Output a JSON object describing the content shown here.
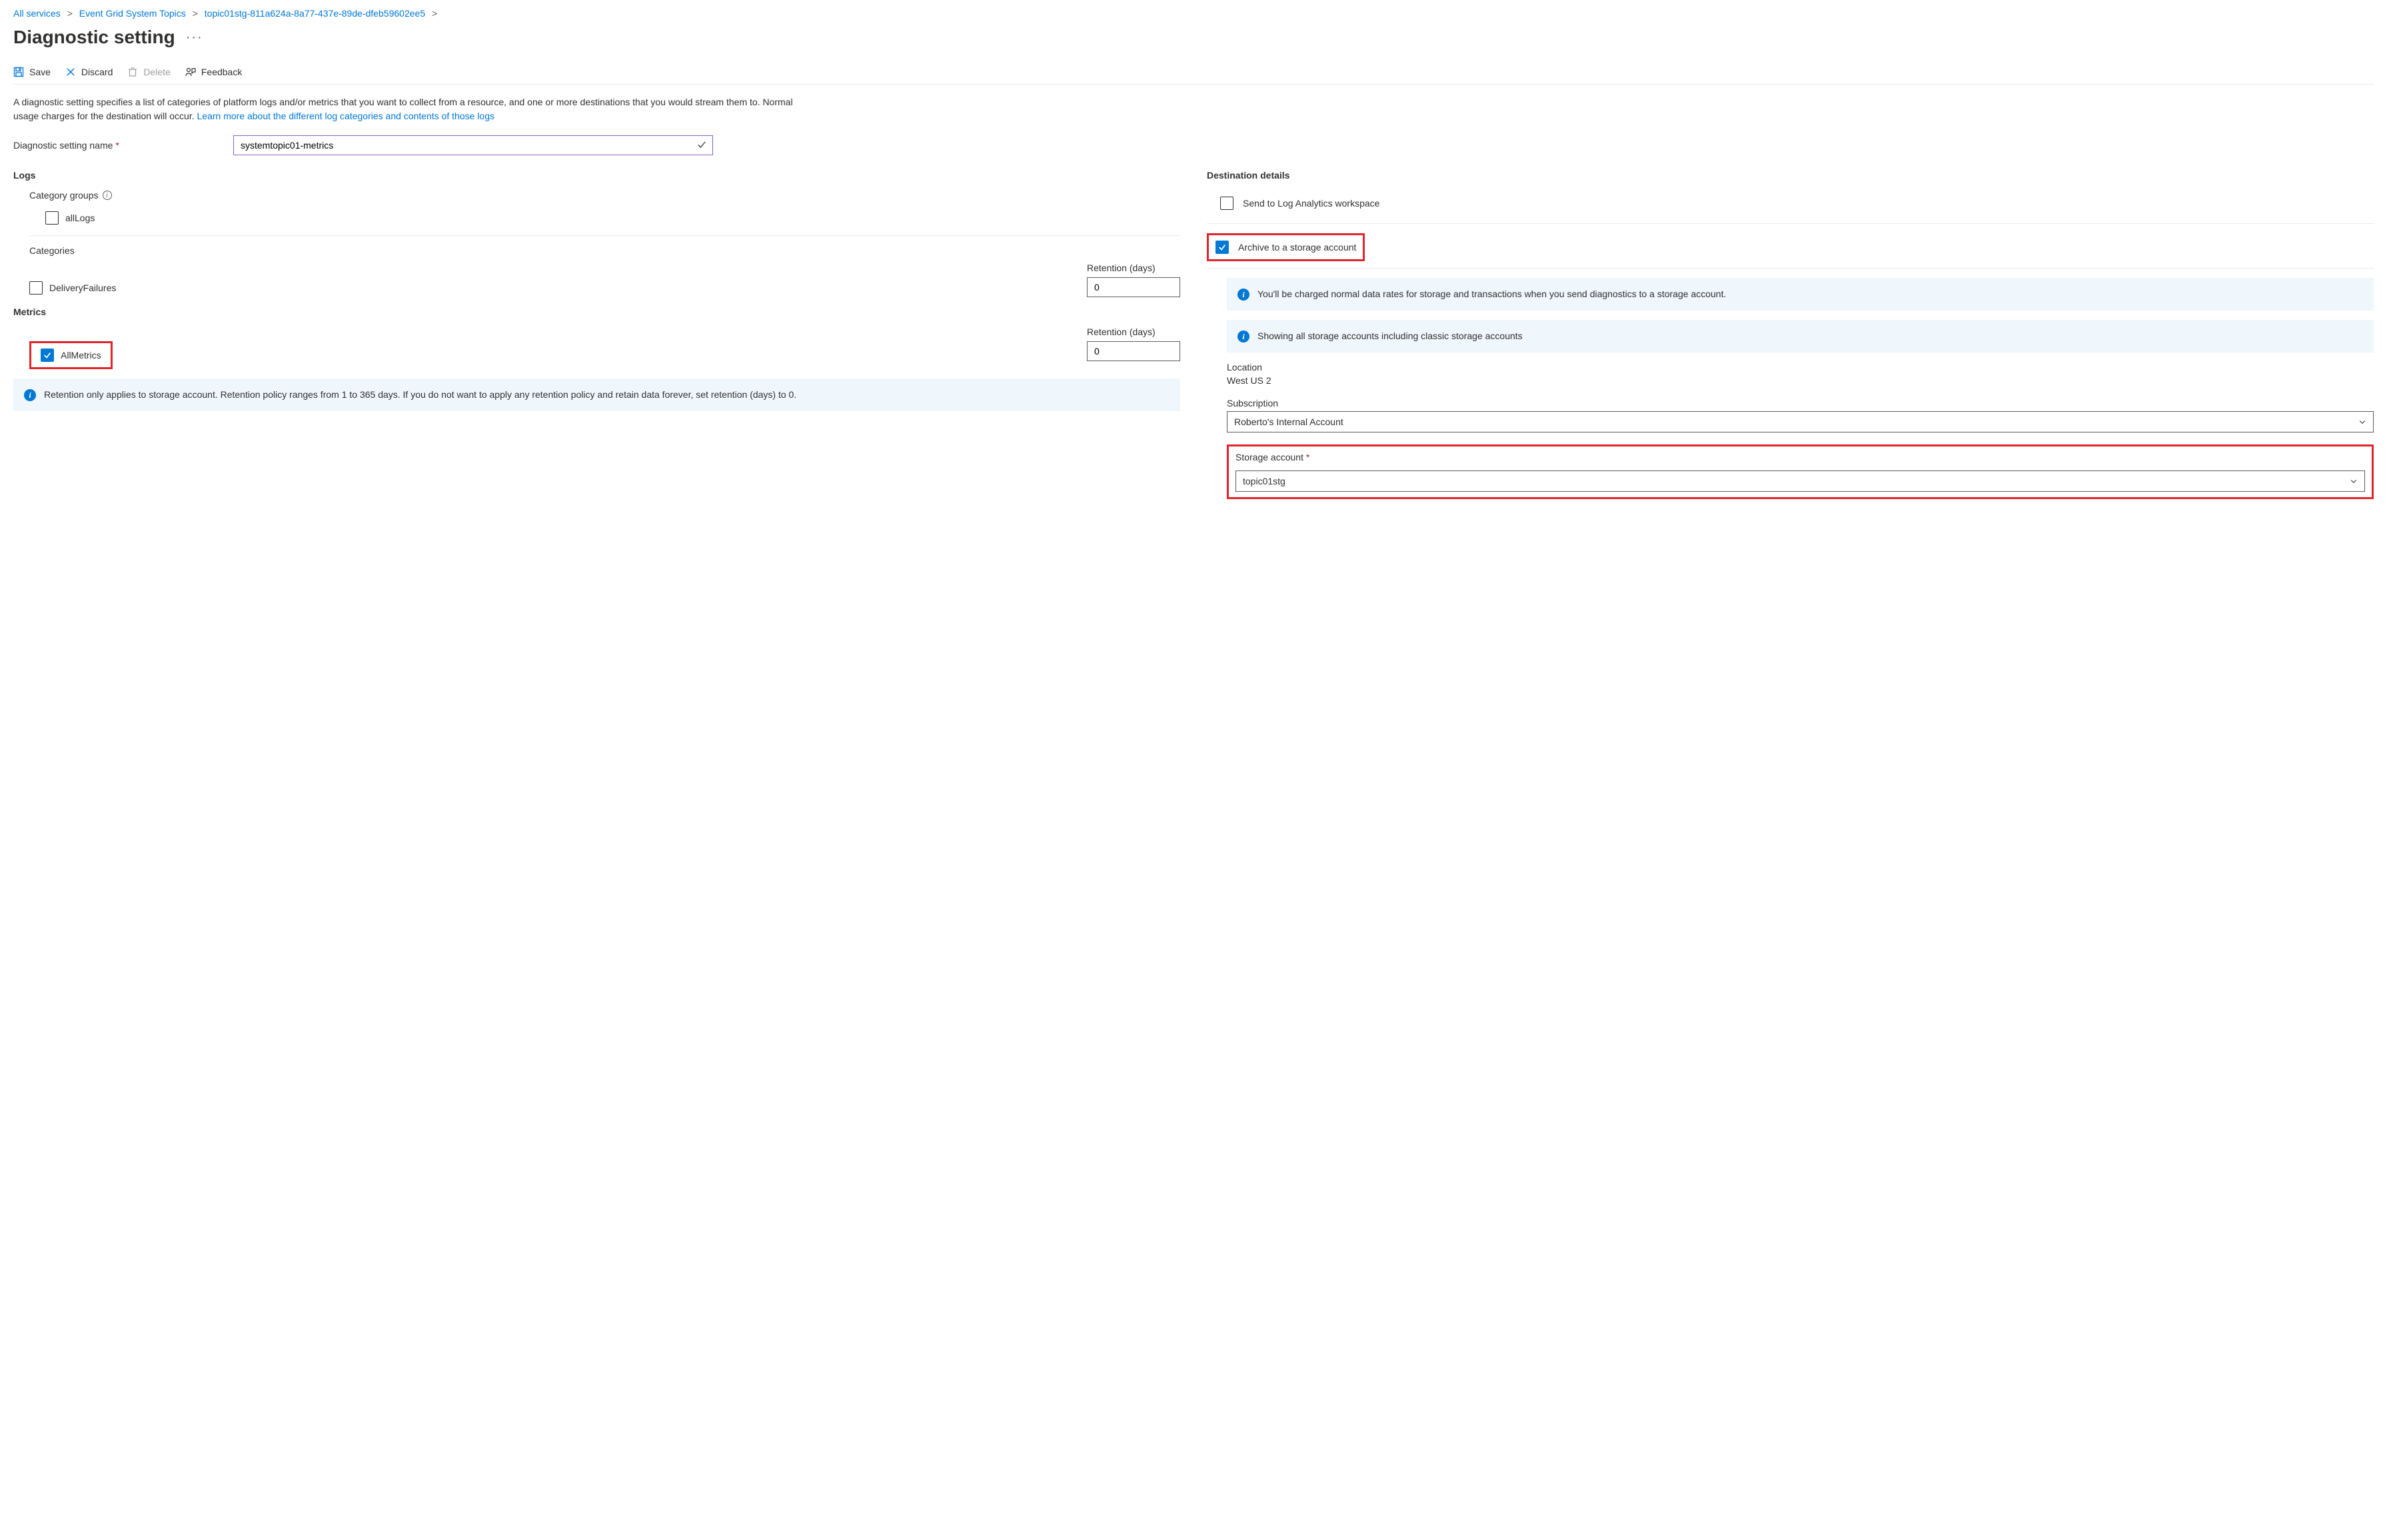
{
  "breadcrumb": {
    "items": [
      "All services",
      "Event Grid System Topics",
      "topic01stg-811a624a-8a77-437e-89de-dfeb59602ee5"
    ]
  },
  "title": "Diagnostic setting",
  "toolbar": {
    "save": "Save",
    "discard": "Discard",
    "delete": "Delete",
    "feedback": "Feedback"
  },
  "description": {
    "text": "A diagnostic setting specifies a list of categories of platform logs and/or metrics that you want to collect from a resource, and one or more destinations that you would stream them to. Normal usage charges for the destination will occur. ",
    "link": "Learn more about the different log categories and contents of those logs"
  },
  "name_field": {
    "label": "Diagnostic setting name",
    "value": "systemtopic01-metrics"
  },
  "logs": {
    "heading": "Logs",
    "category_groups_label": "Category groups",
    "all_logs": {
      "label": "allLogs",
      "checked": false
    },
    "categories_label": "Categories",
    "delivery_failures": {
      "label": "DeliveryFailures",
      "checked": false,
      "retention_label": "Retention (days)",
      "retention_value": "0"
    }
  },
  "metrics": {
    "heading": "Metrics",
    "all_metrics": {
      "label": "AllMetrics",
      "checked": true,
      "retention_label": "Retention (days)",
      "retention_value": "0"
    }
  },
  "retention_note": "Retention only applies to storage account. Retention policy ranges from 1 to 365 days. If you do not want to apply any retention policy and retain data forever, set retention (days) to 0.",
  "dest": {
    "heading": "Destination details",
    "log_analytics": {
      "label": "Send to Log Analytics workspace",
      "checked": false
    },
    "archive": {
      "label": "Archive to a storage account",
      "checked": true
    },
    "charge_note": "You'll be charged normal data rates for storage and transactions when you send diagnostics to a storage account.",
    "classic_note": "Showing all storage accounts including classic storage accounts",
    "location_label": "Location",
    "location_value": "West US 2",
    "subscription_label": "Subscription",
    "subscription_value": "Roberto's Internal Account",
    "storage_label": "Storage account",
    "storage_value": "topic01stg"
  }
}
